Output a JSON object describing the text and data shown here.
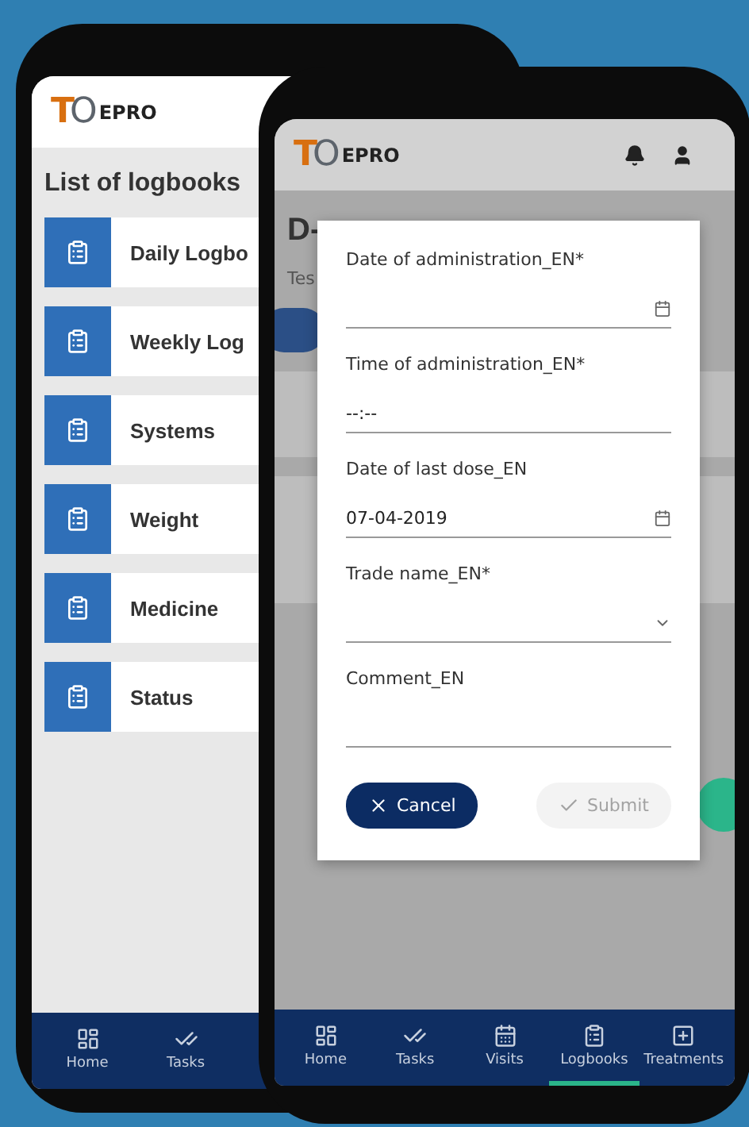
{
  "back_phone": {
    "logo": {
      "mark": "TO",
      "name": "EPRO"
    },
    "title": "List of logbooks",
    "logbooks": [
      {
        "label": "Daily Logbo"
      },
      {
        "label": "Weekly Log"
      },
      {
        "label": "Systems"
      },
      {
        "label": "Weight"
      },
      {
        "label": "Medicine"
      },
      {
        "label": "Status"
      }
    ],
    "nav": [
      {
        "kind": "home",
        "label": "Home",
        "selected": false
      },
      {
        "kind": "tasks",
        "label": "Tasks",
        "selected": false
      }
    ]
  },
  "front_phone": {
    "logo": {
      "mark": "TO",
      "name": "EPRO"
    },
    "title": "D-",
    "subtitle": "Tes",
    "dialog": {
      "fields": [
        {
          "kind": "date",
          "label": "Date of administration_EN*"
        },
        {
          "kind": "time",
          "label": "Time of administration_EN*",
          "value": "--:--"
        },
        {
          "kind": "date",
          "label": "Date of last dose_EN",
          "value": "07-04-2019"
        },
        {
          "kind": "select",
          "label": "Trade name_EN*"
        },
        {
          "kind": "text",
          "label": "Comment_EN"
        }
      ],
      "buttons": [
        {
          "kind": "cancel",
          "label": "Cancel",
          "disabled": false
        },
        {
          "kind": "submit",
          "label": "Submit",
          "disabled": true
        }
      ]
    },
    "nav": [
      {
        "kind": "home",
        "label": "Home",
        "selected": false
      },
      {
        "kind": "tasks",
        "label": "Tasks",
        "selected": false
      },
      {
        "kind": "visits",
        "label": "Visits",
        "selected": false
      },
      {
        "kind": "logbooks",
        "label": "Logbooks",
        "selected": true
      },
      {
        "kind": "treatments",
        "label": "Treatments",
        "selected": false
      }
    ]
  }
}
